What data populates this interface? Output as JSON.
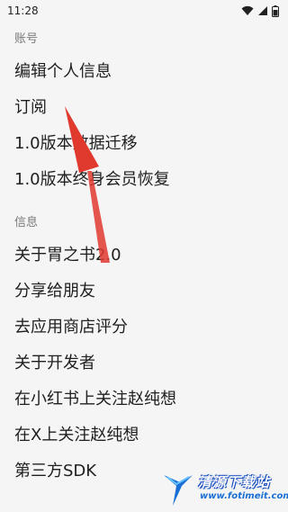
{
  "status_bar": {
    "time": "11:28"
  },
  "sections": [
    {
      "header": "账号",
      "items": [
        "编辑个人信息",
        "订阅",
        "1.0版本数据迁移",
        "1.0版本终身会员恢复"
      ]
    },
    {
      "header": "信息",
      "items": [
        "关于胃之书2.0",
        "分享给朋友",
        "去应用商店评分",
        "关于开发者",
        "在小红书上关注赵纯想",
        "在X上关注赵纯想",
        "第三方SDK"
      ]
    }
  ],
  "watermark": {
    "title": "清源下载站",
    "url": "www.fotimeit.com"
  },
  "colors": {
    "background": "#f5f5f5",
    "annotation_arrow": "#e03a2f",
    "watermark_blue": "#1a6fd6"
  }
}
